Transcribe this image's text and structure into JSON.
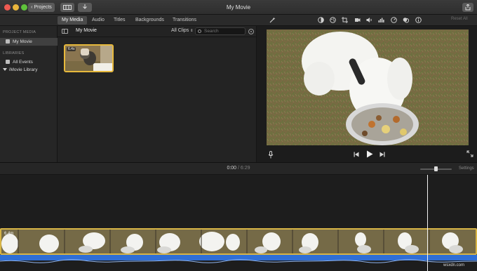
{
  "window": {
    "title": "My Movie",
    "projects_label": "Projects",
    "projects_icon": "chevron-left-icon"
  },
  "tabs": [
    {
      "label": "My Media",
      "active": true
    },
    {
      "label": "Audio",
      "active": false
    },
    {
      "label": "Titles",
      "active": false
    },
    {
      "label": "Backgrounds",
      "active": false
    },
    {
      "label": "Transitions",
      "active": false
    }
  ],
  "sidebar": {
    "project_media_heading": "PROJECT MEDIA",
    "project_item": "My Movie",
    "libraries_heading": "LIBRARIES",
    "all_events": "All Events",
    "library": "iMovie Library"
  },
  "browser": {
    "title": "My Movie",
    "filter": "All Clips",
    "search_placeholder": "Search",
    "clip_duration": "6.4s"
  },
  "viewer": {
    "reset_all": "Reset All",
    "tools": [
      "magic-wand-icon",
      "color-balance-icon",
      "color-correction-icon",
      "crop-icon",
      "stabilization-icon",
      "volume-icon",
      "noise-reduction-icon",
      "speed-icon",
      "filter-icon",
      "info-icon"
    ]
  },
  "timeline": {
    "current_time": "0:00",
    "separator": "/",
    "total_time": "6:29",
    "settings_label": "Settings",
    "clip_label": "6.4m"
  },
  "watermark": "wsxdn.com",
  "colors": {
    "accent": "#e7b93c",
    "audio": "#2f6fd6",
    "background": "#1e1e1e"
  }
}
